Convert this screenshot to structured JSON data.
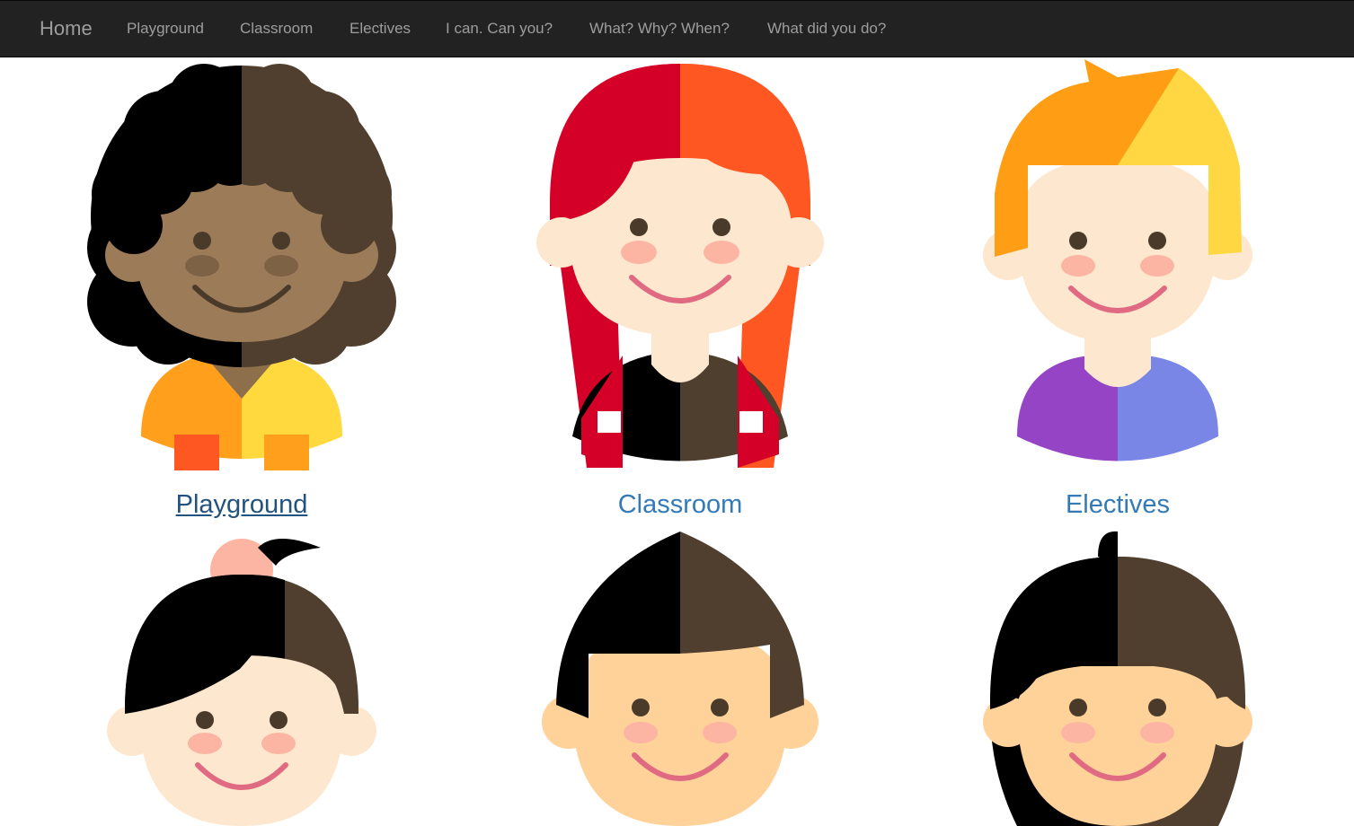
{
  "navbar": {
    "brand": "Home",
    "links": [
      "Playground",
      "Classroom",
      "Electives",
      "I can. Can you?",
      "What? Why? When?",
      "What did you do?"
    ]
  },
  "tiles": [
    {
      "caption": "Playground",
      "avatar": "curly-hair-kid-icon"
    },
    {
      "caption": "Classroom",
      "avatar": "red-hair-girl-icon"
    },
    {
      "caption": "Electives",
      "avatar": "blond-boy-icon"
    },
    {
      "avatar": "ponytail-girl-icon"
    },
    {
      "avatar": "brown-hair-boy-icon"
    },
    {
      "avatar": "long-hair-girl-icon"
    }
  ],
  "colors": {
    "navbar_bg": "#222222",
    "nav_text": "#9d9d9d",
    "link": "#337ab7",
    "link_hover": "#23527c"
  }
}
